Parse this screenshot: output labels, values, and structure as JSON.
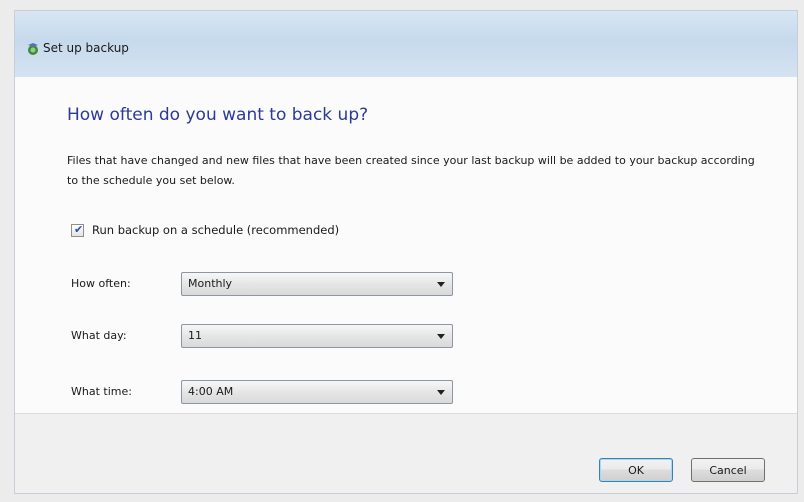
{
  "window": {
    "title": "Set up backup"
  },
  "main": {
    "heading": "How often do you want to back up?",
    "description": "Files that have changed and new files that have been created since your last backup will be added to your backup according to the schedule you set below.",
    "schedule_checkbox": {
      "label": "Run backup on a schedule (recommended)",
      "checked": true
    },
    "fields": [
      {
        "label": "How often:",
        "value": "Monthly"
      },
      {
        "label": "What day:",
        "value": "11"
      },
      {
        "label": "What time:",
        "value": "4:00 AM"
      }
    ]
  },
  "footer": {
    "ok_label": "OK",
    "cancel_label": "Cancel"
  },
  "icons": {
    "title": "backup-icon",
    "dropdown": "chevron-down-icon",
    "check": "checkmark-icon"
  },
  "colors": {
    "heading": "#2b3a98",
    "titlebar": "#c6daec",
    "checkmark": "#2a4aa7"
  }
}
